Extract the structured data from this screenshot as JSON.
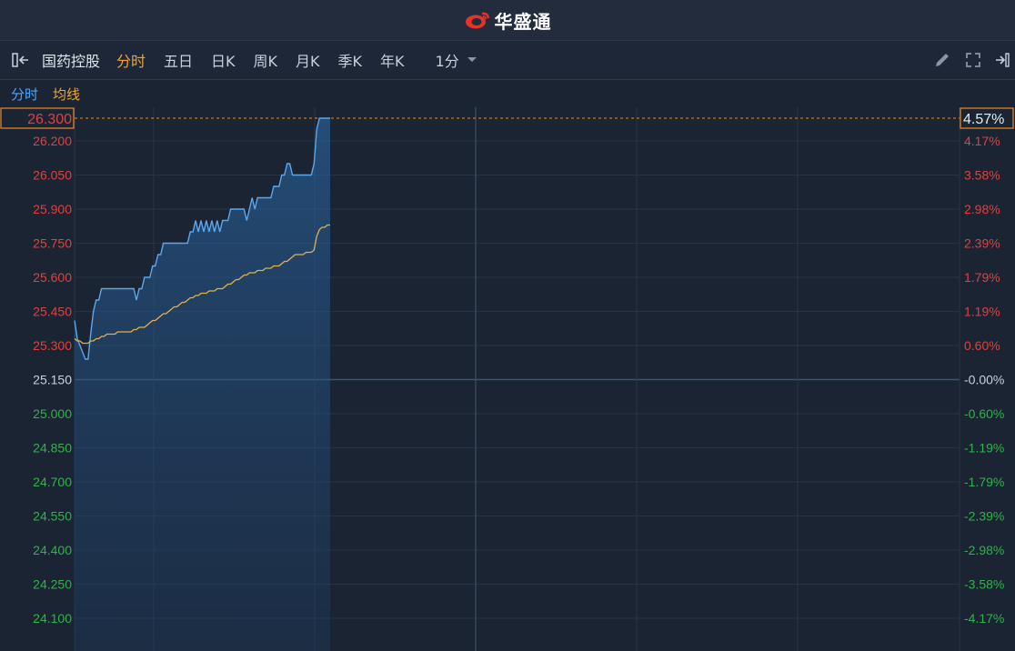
{
  "brand": {
    "name": "华盛通"
  },
  "toolbar": {
    "stock_name": "国药控股",
    "tabs": [
      "分时",
      "五日",
      "日K",
      "周K",
      "月K",
      "季K",
      "年K"
    ],
    "active_tab": "分时",
    "interval": "1分",
    "icons": [
      "collapse-panel-icon",
      "pencil-icon",
      "fullscreen-icon",
      "expand-right-icon"
    ]
  },
  "legend": {
    "price_label": "分时",
    "avg_label": "均线"
  },
  "colors": {
    "price_line": "#5aa8f0",
    "avg_line": "#e3b14a",
    "up": "#e2403d",
    "down": "#2fb34a",
    "neutral": "#c8d0dc",
    "highlight": "#f08a24"
  },
  "chart_data": {
    "type": "line",
    "prev_close": 25.15,
    "current_price": 26.3,
    "current_pct": "4.57%",
    "current_label": "26.300",
    "y_range": [
      24.1,
      26.3
    ],
    "x_minutes_total": 330,
    "left_ticks": [
      "26.200",
      "26.050",
      "25.900",
      "25.750",
      "25.600",
      "25.450",
      "25.300",
      "25.150",
      "25.000",
      "24.850",
      "24.700",
      "24.550",
      "24.400",
      "24.250",
      "24.100"
    ],
    "left_tick_values": [
      26.2,
      26.05,
      25.9,
      25.75,
      25.6,
      25.45,
      25.3,
      25.15,
      25.0,
      24.85,
      24.7,
      24.55,
      24.4,
      24.25,
      24.1
    ],
    "right_ticks": [
      "4.17%",
      "3.58%",
      "2.98%",
      "2.39%",
      "1.79%",
      "1.19%",
      "0.60%",
      "-0.00%",
      "-0.60%",
      "-1.19%",
      "-1.79%",
      "-2.39%",
      "-2.98%",
      "-3.58%",
      "-4.17%"
    ],
    "series": [
      {
        "name": "分时",
        "x": [
          0,
          1,
          2,
          3,
          4,
          5,
          6,
          7,
          8,
          9,
          10,
          11,
          12,
          13,
          14,
          15,
          16,
          17,
          18,
          19,
          20,
          21,
          22,
          23,
          24,
          25,
          26,
          27,
          28,
          29,
          30,
          31,
          32,
          33,
          34,
          35,
          36,
          37,
          38,
          39,
          40,
          41,
          42,
          43,
          44,
          45,
          46,
          47,
          48,
          49,
          50,
          51,
          52,
          53,
          54,
          55,
          56,
          57,
          58,
          59,
          60,
          61,
          62,
          63,
          64,
          65,
          66,
          67,
          68,
          69,
          70,
          71,
          72,
          73,
          74,
          75,
          76,
          77,
          78,
          79,
          80,
          81,
          82,
          83,
          84,
          85,
          86,
          87,
          88,
          89,
          90,
          91,
          92,
          93,
          94,
          95
        ],
        "values": [
          25.41,
          25.33,
          25.3,
          25.27,
          25.24,
          25.24,
          25.35,
          25.45,
          25.5,
          25.5,
          25.55,
          25.55,
          25.55,
          25.55,
          25.55,
          25.55,
          25.55,
          25.55,
          25.55,
          25.55,
          25.55,
          25.55,
          25.55,
          25.5,
          25.55,
          25.55,
          25.6,
          25.6,
          25.6,
          25.65,
          25.65,
          25.7,
          25.7,
          25.75,
          25.75,
          25.75,
          25.75,
          25.75,
          25.75,
          25.75,
          25.75,
          25.75,
          25.75,
          25.8,
          25.8,
          25.85,
          25.8,
          25.85,
          25.8,
          25.85,
          25.8,
          25.85,
          25.8,
          25.85,
          25.8,
          25.85,
          25.85,
          25.85,
          25.9,
          25.9,
          25.9,
          25.9,
          25.9,
          25.9,
          25.85,
          25.9,
          25.95,
          25.9,
          25.95,
          25.95,
          25.95,
          25.95,
          25.95,
          25.95,
          26.0,
          26.0,
          26.0,
          26.05,
          26.05,
          26.1,
          26.1,
          26.05,
          26.05,
          26.05,
          26.05,
          26.05,
          26.05,
          26.05,
          26.05,
          26.1,
          26.25,
          26.3,
          26.3,
          26.3,
          26.3,
          26.3
        ]
      },
      {
        "name": "均线",
        "x": [
          0,
          1,
          2,
          3,
          4,
          5,
          6,
          7,
          8,
          9,
          10,
          11,
          12,
          13,
          14,
          15,
          16,
          17,
          18,
          19,
          20,
          21,
          22,
          23,
          24,
          25,
          26,
          27,
          28,
          29,
          30,
          31,
          32,
          33,
          34,
          35,
          36,
          37,
          38,
          39,
          40,
          41,
          42,
          43,
          44,
          45,
          46,
          47,
          48,
          49,
          50,
          51,
          52,
          53,
          54,
          55,
          56,
          57,
          58,
          59,
          60,
          61,
          62,
          63,
          64,
          65,
          66,
          67,
          68,
          69,
          70,
          71,
          72,
          73,
          74,
          75,
          76,
          77,
          78,
          79,
          80,
          81,
          82,
          83,
          84,
          85,
          86,
          87,
          88,
          89,
          90,
          91,
          92,
          93,
          94,
          95
        ],
        "values": [
          25.33,
          25.32,
          25.32,
          25.31,
          25.31,
          25.31,
          25.32,
          25.32,
          25.33,
          25.33,
          25.34,
          25.34,
          25.35,
          25.35,
          25.35,
          25.35,
          25.36,
          25.36,
          25.36,
          25.36,
          25.36,
          25.36,
          25.37,
          25.37,
          25.38,
          25.38,
          25.38,
          25.39,
          25.4,
          25.41,
          25.41,
          25.42,
          25.43,
          25.44,
          25.44,
          25.45,
          25.46,
          25.47,
          25.47,
          25.48,
          25.49,
          25.49,
          25.5,
          25.51,
          25.51,
          25.52,
          25.52,
          25.53,
          25.53,
          25.53,
          25.54,
          25.54,
          25.54,
          25.55,
          25.55,
          25.55,
          25.56,
          25.57,
          25.57,
          25.58,
          25.59,
          25.59,
          25.6,
          25.61,
          25.61,
          25.62,
          25.62,
          25.62,
          25.63,
          25.63,
          25.63,
          25.64,
          25.64,
          25.64,
          25.65,
          25.65,
          25.65,
          25.66,
          25.67,
          25.67,
          25.68,
          25.69,
          25.7,
          25.7,
          25.7,
          25.7,
          25.71,
          25.71,
          25.71,
          25.72,
          25.78,
          25.81,
          25.82,
          25.82,
          25.83,
          25.83
        ]
      }
    ],
    "grid": true
  }
}
